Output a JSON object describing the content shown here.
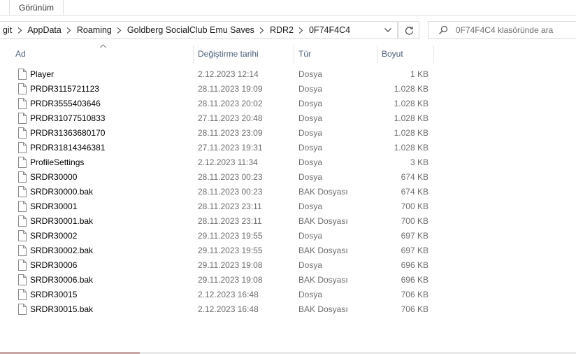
{
  "ribbon": {
    "tab_label": "Görünüm"
  },
  "address": {
    "crumbs": [
      "git",
      "AppData",
      "Roaming",
      "Goldberg SocialClub Emu Saves",
      "RDR2",
      "0F74F4C4"
    ]
  },
  "search": {
    "placeholder": "0F74F4C4 klasöründe ara"
  },
  "columns": {
    "name": "Ad",
    "date": "Değiştirme tarihi",
    "type": "Tür",
    "size": "Boyut"
  },
  "files": [
    {
      "name": "Player",
      "date": "2.12.2023 12:14",
      "type": "Dosya",
      "size": "1 KB"
    },
    {
      "name": "PRDR3115721123",
      "date": "28.11.2023 19:09",
      "type": "Dosya",
      "size": "1.028 KB"
    },
    {
      "name": "PRDR3555403646",
      "date": "28.11.2023 20:02",
      "type": "Dosya",
      "size": "1.028 KB"
    },
    {
      "name": "PRDR31077510833",
      "date": "27.11.2023 20:48",
      "type": "Dosya",
      "size": "1.028 KB"
    },
    {
      "name": "PRDR31363680170",
      "date": "28.11.2023 23:09",
      "type": "Dosya",
      "size": "1.028 KB"
    },
    {
      "name": "PRDR31814346381",
      "date": "27.11.2023 19:31",
      "type": "Dosya",
      "size": "1.028 KB"
    },
    {
      "name": "ProfileSettings",
      "date": "2.12.2023 11:34",
      "type": "Dosya",
      "size": "3 KB"
    },
    {
      "name": "SRDR30000",
      "date": "28.11.2023 00:23",
      "type": "Dosya",
      "size": "674 KB"
    },
    {
      "name": "SRDR30000.bak",
      "date": "28.11.2023 00:23",
      "type": "BAK Dosyası",
      "size": "674 KB"
    },
    {
      "name": "SRDR30001",
      "date": "28.11.2023 23:11",
      "type": "Dosya",
      "size": "700 KB"
    },
    {
      "name": "SRDR30001.bak",
      "date": "28.11.2023 23:11",
      "type": "BAK Dosyası",
      "size": "700 KB"
    },
    {
      "name": "SRDR30002",
      "date": "29.11.2023 19:55",
      "type": "Dosya",
      "size": "697 KB"
    },
    {
      "name": "SRDR30002.bak",
      "date": "29.11.2023 19:55",
      "type": "BAK Dosyası",
      "size": "697 KB"
    },
    {
      "name": "SRDR30006",
      "date": "29.11.2023 19:08",
      "type": "Dosya",
      "size": "696 KB"
    },
    {
      "name": "SRDR30006.bak",
      "date": "29.11.2023 19:08",
      "type": "BAK Dosyası",
      "size": "696 KB"
    },
    {
      "name": "SRDR30015",
      "date": "2.12.2023 16:48",
      "type": "Dosya",
      "size": "706 KB"
    },
    {
      "name": "SRDR30015.bak",
      "date": "2.12.2023 16:48",
      "type": "BAK Dosyası",
      "size": "706 KB"
    }
  ],
  "icons": {
    "file": "file-icon",
    "chevron": "chevron-right-icon",
    "dropdown": "chevron-down-icon",
    "refresh": "refresh-icon",
    "search": "search-icon",
    "sort": "sort-ascending-icon"
  }
}
